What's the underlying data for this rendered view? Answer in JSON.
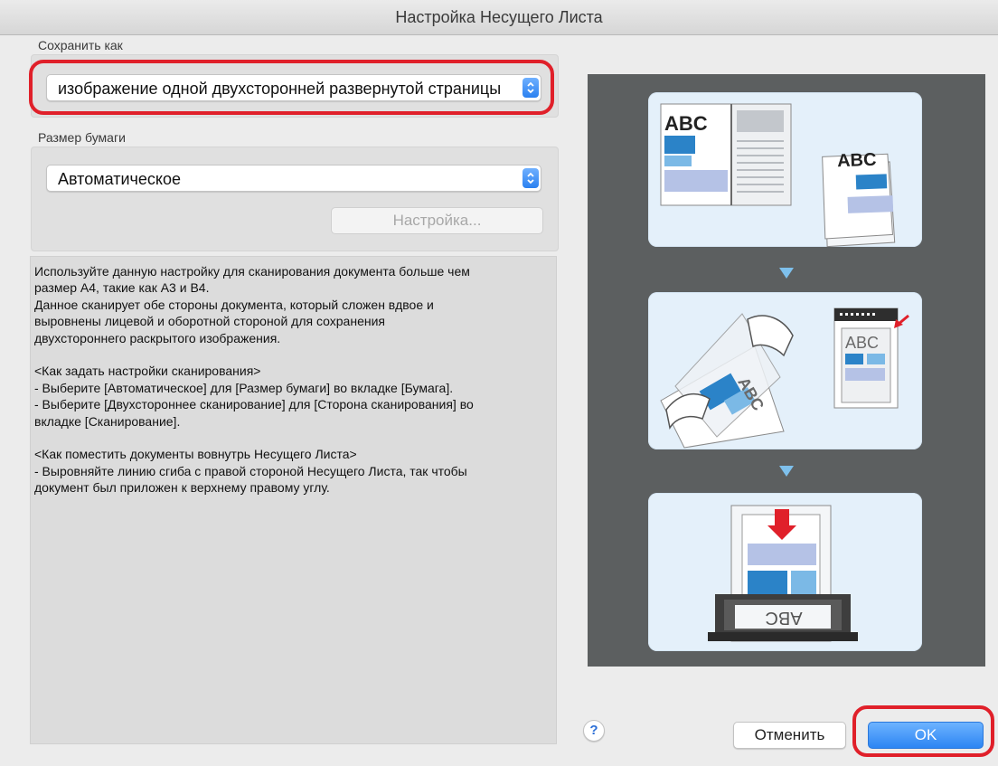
{
  "window": {
    "title": "Настройка Несущего Листа"
  },
  "save_as": {
    "label": "Сохранить как",
    "value": "изображение одной двухсторонней развернутой страницы"
  },
  "paper_size": {
    "label": "Размер бумаги",
    "value": "Автоматическое",
    "settings_button": "Настройка..."
  },
  "description": {
    "lines": [
      "Используйте данную настройку для сканирования документа больше чем",
      "размер A4, такие как A3 и B4.",
      "Данное сканирует обе стороны документа, который сложен вдвое и",
      "выровнены лицевой и оборотной стороной для сохранения",
      "двухстороннего раскрытого изображения.",
      "",
      "<Как задать настройки сканирования>",
      "- Выберите [Автоматическое] для [Размер бумаги] во вкладке [Бумага].",
      "- Выберите [Двухстороннее сканирование] для [Сторона сканирования] во",
      "вкладке [Сканирование].",
      "",
      "<Как поместить документы вовнутрь Несущего Листа>",
      "- Выровняйте линию сгиба с правой стороной Несущего Листа, так чтобы",
      "документ был приложен к верхнему правому углу."
    ]
  },
  "illustration": {
    "card1_text_a": "ABC",
    "card1_text_b": "ABC",
    "card2_text_a": "ABC",
    "card2_text_b": "ABC",
    "card3_text": "ABC"
  },
  "buttons": {
    "help": "?",
    "cancel": "Отменить",
    "ok": "OK"
  },
  "colors": {
    "highlight_ring": "#e0202a",
    "accent_blue": "#2c85f3",
    "illustration_bg": "#5c5f60"
  }
}
